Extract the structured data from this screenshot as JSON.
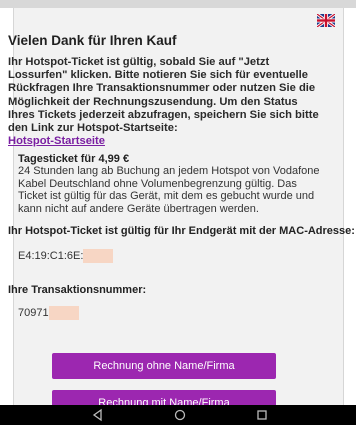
{
  "header": {
    "language_flag": "uk-flag-icon"
  },
  "page": {
    "title": "Vielen Dank für Ihren Kauf",
    "info_text": "Ihr Hotspot-Ticket ist gültig, sobald Sie auf \"Jetzt Lossurfen\" klicken. Bitte notieren Sie sich für eventuelle Rückfragen Ihre Transaktionsnummer oder nutzen Sie die Möglichkeit der Rechnungszusendung. Um den Status Ihres Tickets jederzeit abzufragen, speichern Sie sich bitte den Link zur Hotspot-Startseite:",
    "start_link": "Hotspot-Startseite"
  },
  "ticket": {
    "name": "Tagesticket für 4,99 €",
    "description": "24 Stunden lang ab Buchung an jedem Hotspot von Vodafone Kabel Deutschland ohne Volumenbegrenzung gültig. Das Ticket ist gültig für das Gerät, mit dem es gebucht wurde und kann nicht auf andere Geräte übertragen werden."
  },
  "mac": {
    "label": "Ihr Hotspot-Ticket ist gültig für Ihr Endgerät mit der MAC-Adresse:",
    "value": "E4:19:C1:6E:"
  },
  "transaction": {
    "label": "Ihre Transaktionsnummer:",
    "value": "70971"
  },
  "buttons": {
    "invoice_without_name": "Rechnung ohne Name/Firma",
    "invoice_with_name": "Rechnung mit Name/Firma"
  },
  "navbar": {
    "back": "back-icon",
    "home": "home-icon",
    "recents": "recents-icon"
  }
}
